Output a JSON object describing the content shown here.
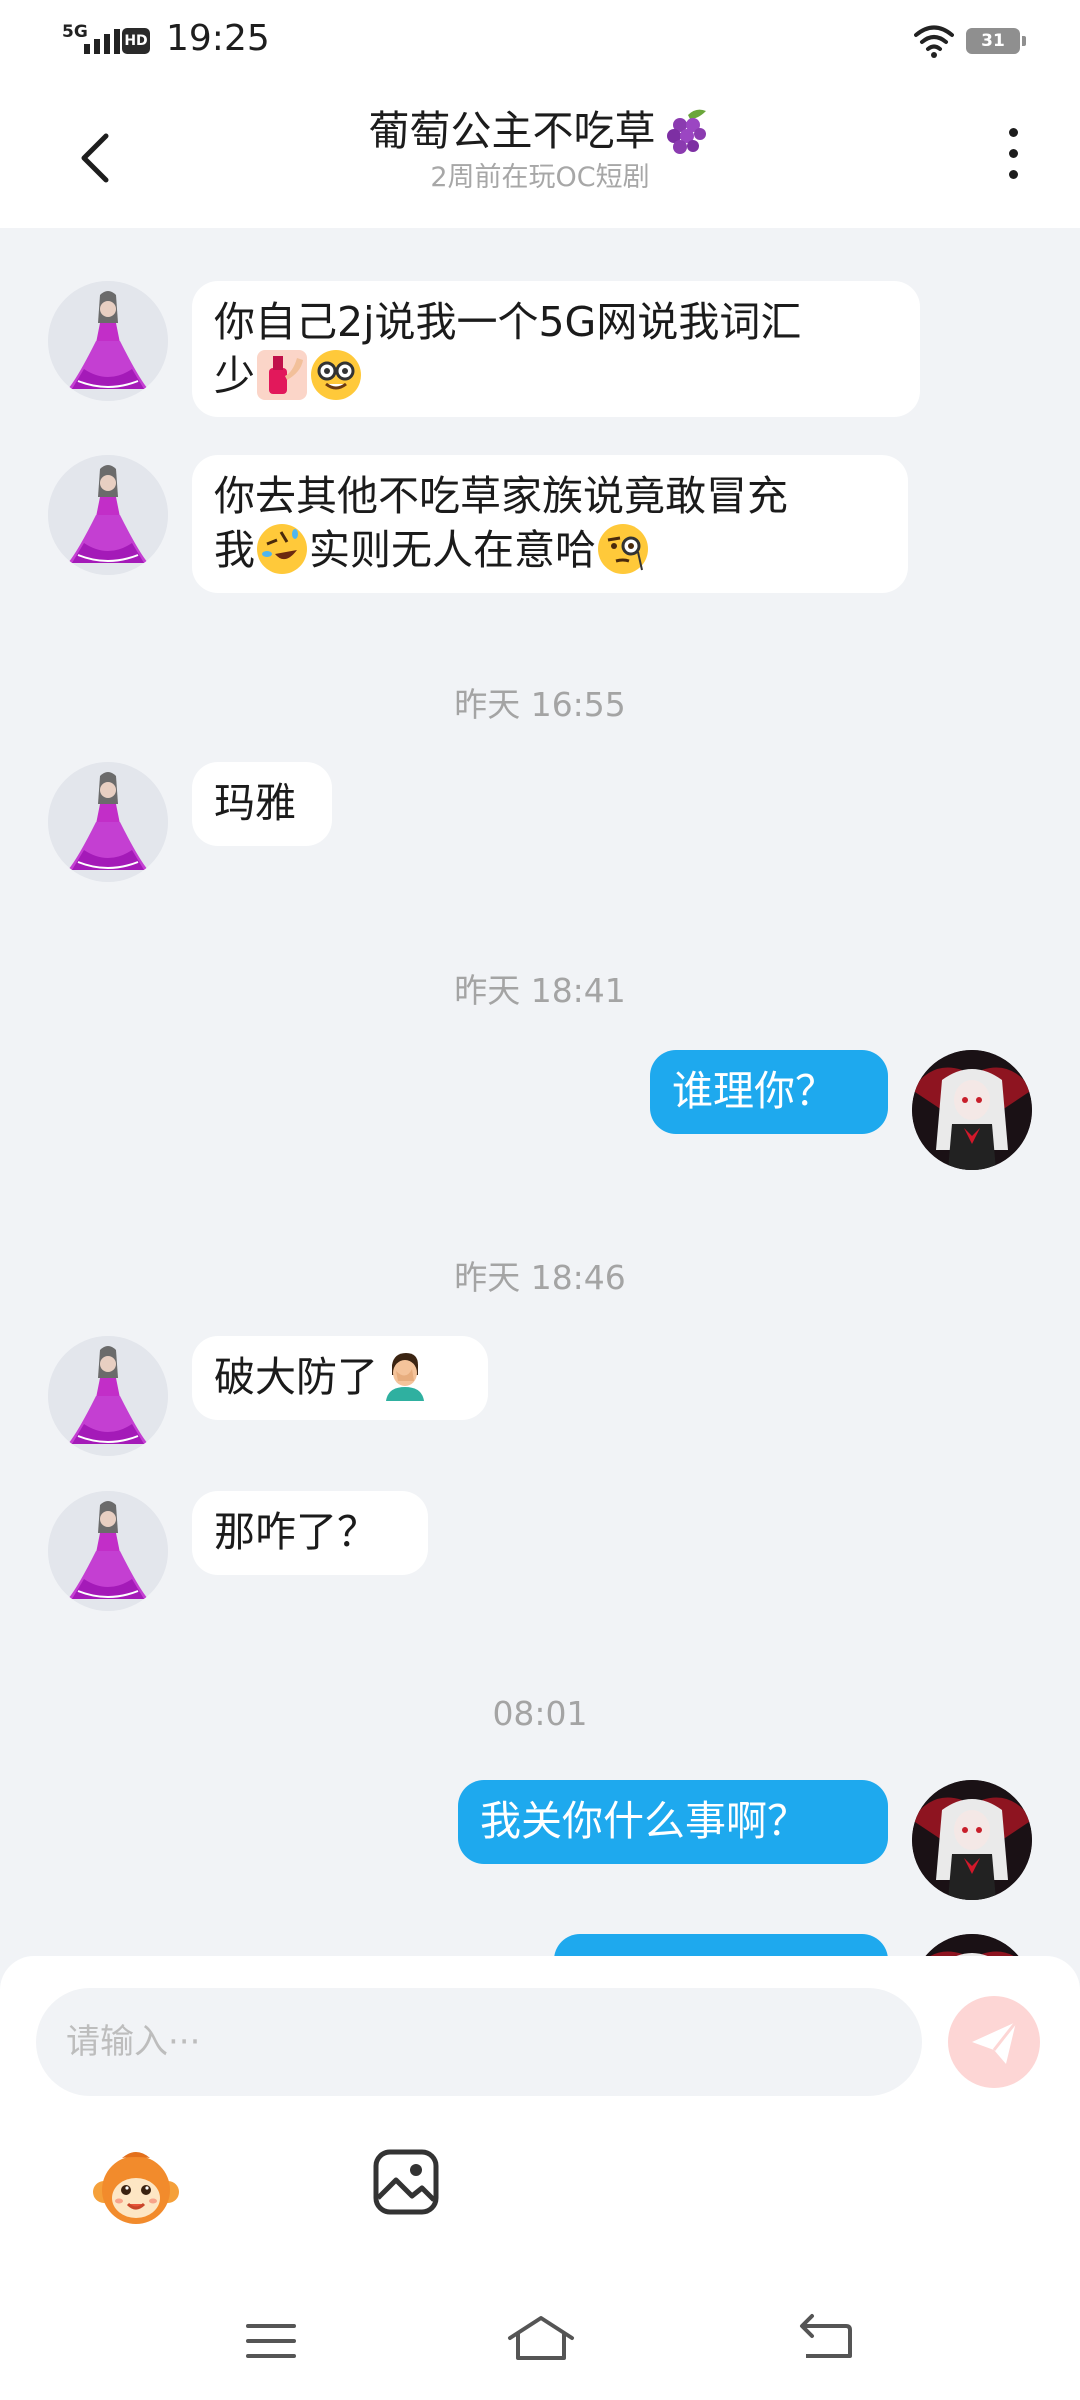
{
  "status_bar": {
    "network": "5G",
    "hd": "HD",
    "time": "19:25",
    "battery": "31",
    "icons": [
      "signal-icon",
      "hd-icon",
      "wifi-icon",
      "battery-icon"
    ]
  },
  "header": {
    "back_icon": "chevron-left-icon",
    "title": "葡萄公主不吃草",
    "title_emoji": "grape-icon",
    "subtitle": "2周前在玩OC短剧",
    "more_icon": "more-vertical-icon"
  },
  "messages": [
    {
      "sender": "peer",
      "text_line1": "你自己2j说我一个5G网说我词汇",
      "text_line2": "少",
      "emojis": [
        "nail-polish-emoji",
        "nerd-face-emoji"
      ]
    },
    {
      "sender": "peer",
      "text_line1": "你去其他不吃草家族说竟敢冒充",
      "text_line2_a": "我",
      "text_line2_b": "实则无人在意哈",
      "emojis": [
        "rolling-laughing-emoji",
        "monocle-face-emoji"
      ]
    },
    {
      "type": "timestamp",
      "text": "昨天 16:55"
    },
    {
      "sender": "peer",
      "text": "玛雅"
    },
    {
      "type": "timestamp",
      "text": "昨天 18:41"
    },
    {
      "sender": "me",
      "text": "谁理你？"
    },
    {
      "type": "timestamp",
      "text": "昨天 18:46"
    },
    {
      "sender": "peer",
      "text": "破大防了",
      "emojis": [
        "facepalm-emoji"
      ]
    },
    {
      "sender": "peer",
      "text": "那咋了？"
    },
    {
      "type": "timestamp",
      "text": "08:01"
    },
    {
      "sender": "me",
      "text": "我关你什么事啊？"
    },
    {
      "sender": "me",
      "text": "",
      "partial": true
    }
  ],
  "colors": {
    "background": "#f1f3f6",
    "incoming_bubble": "#ffffff",
    "outgoing_bubble": "#1ea9ee",
    "send_button": "#fdd6d5",
    "timestamp": "#a4a4a4"
  },
  "input": {
    "placeholder": "请输入···",
    "value": ""
  },
  "toolbar": {
    "icons": [
      "monkey-mascot-icon",
      "image-icon",
      "send-icon"
    ]
  },
  "nav": {
    "icons": [
      "menu-icon",
      "home-icon",
      "back-icon"
    ]
  }
}
